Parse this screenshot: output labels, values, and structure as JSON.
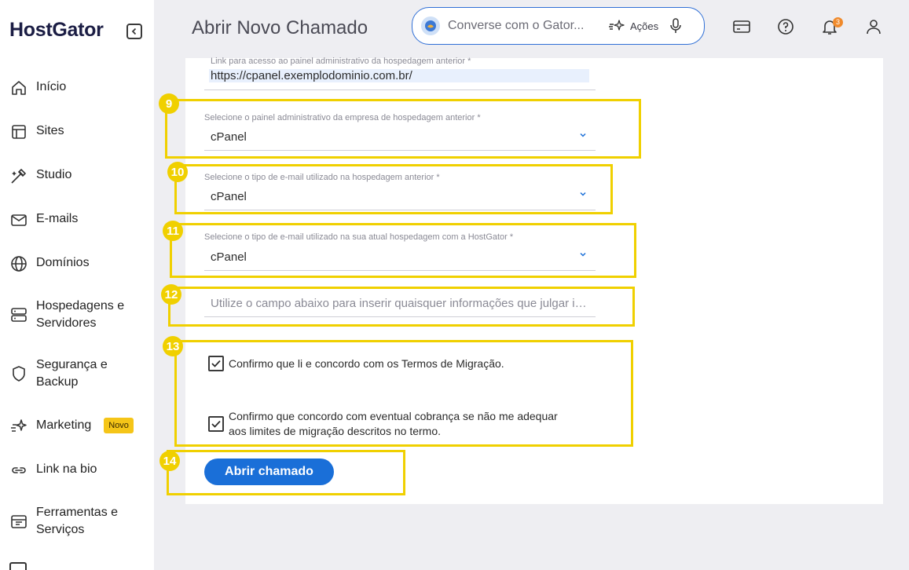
{
  "sidebar": {
    "logo": "HostGator",
    "items": [
      {
        "label": "Início",
        "icon": "home-icon"
      },
      {
        "label": "Sites",
        "icon": "layout-icon"
      },
      {
        "label": "Studio",
        "icon": "studio-icon"
      },
      {
        "label": "E-mails",
        "icon": "mail-icon"
      },
      {
        "label": "Domínios",
        "icon": "globe-icon"
      },
      {
        "label": "Hospedagens e Servidores",
        "icon": "server-icon"
      },
      {
        "label": "Segurança e Backup",
        "icon": "shield-icon"
      },
      {
        "label": "Marketing",
        "icon": "sparkle-icon",
        "badge": "Novo"
      },
      {
        "label": "Link na bio",
        "icon": "link-icon"
      },
      {
        "label": "Ferramentas e Serviços",
        "icon": "tools-icon"
      }
    ]
  },
  "header": {
    "title": "Abrir Novo Chamado",
    "chat_placeholder": "Converse com o Gator...",
    "actions_label": "Ações",
    "notifications_count": "3"
  },
  "form": {
    "previous_panel_link": {
      "label": "Link para acesso ao painel administrativo da hospedagem anterior *",
      "value": "https://cpanel.exemplodominio.com.br/"
    },
    "previous_panel_type": {
      "label": "Selecione o painel administrativo da empresa de hospedagem anterior *",
      "value": "cPanel"
    },
    "previous_email_type": {
      "label": "Selecione o tipo de e-mail utilizado na hospedagem anterior *",
      "value": "cPanel"
    },
    "current_email_type": {
      "label": "Selecione o tipo de e-mail utilizado na sua atual hospedagem com a HostGator *",
      "value": "cPanel"
    },
    "notes": {
      "placeholder": "Utilize o campo abaixo para inserir quaisquer informações que julgar importantes"
    },
    "terms_checkbox": {
      "label": "Confirmo que li e concordo com os Termos de Migração.",
      "checked": true
    },
    "charges_checkbox": {
      "label_line1": "Confirmo que concordo com eventual cobrança se não me adequar",
      "label_line2": "aos limites de migração descritos no termo.",
      "checked": true
    },
    "submit_label": "Abrir chamado"
  },
  "annotations": [
    "9",
    "10",
    "11",
    "12",
    "13",
    "14"
  ],
  "colors": {
    "highlight": "#f0d000",
    "primary": "#1a6fd8",
    "notification": "#f08a2c"
  }
}
